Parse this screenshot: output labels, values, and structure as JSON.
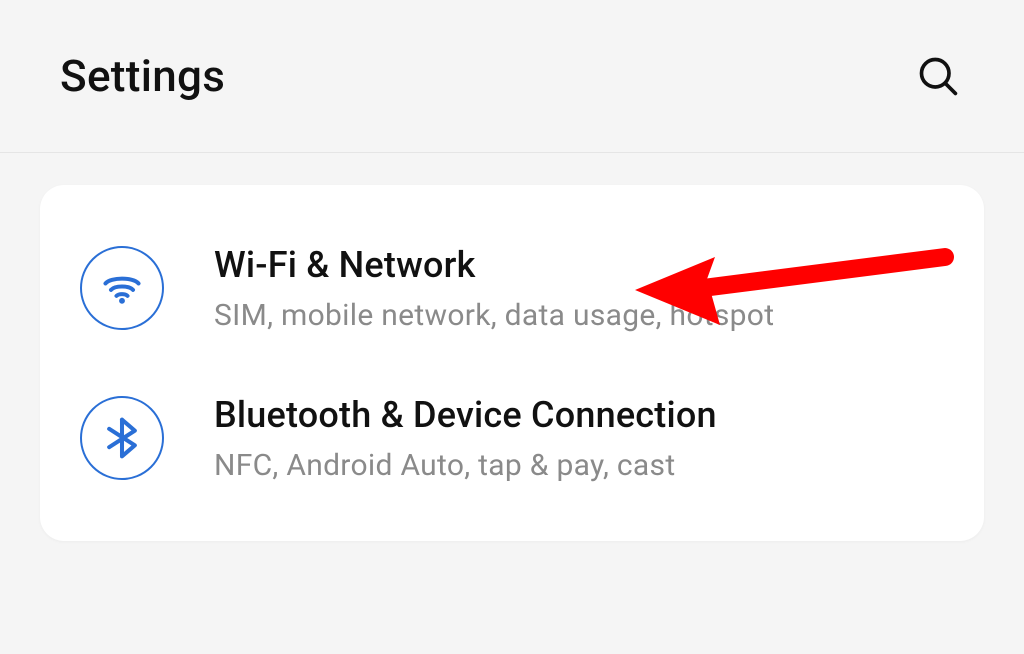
{
  "header": {
    "title": "Settings"
  },
  "items": [
    {
      "title": "Wi-Fi & Network",
      "subtitle": "SIM, mobile network, data usage, hotspot"
    },
    {
      "title": "Bluetooth & Device Connection",
      "subtitle": "NFC, Android Auto, tap & pay, cast"
    }
  ]
}
